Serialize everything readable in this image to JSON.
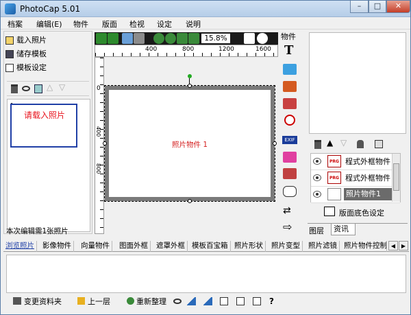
{
  "window": {
    "title": "PhotoCap 5.01",
    "controls": {
      "minimize": "–",
      "maximize": "□",
      "close": "✕"
    }
  },
  "menu": [
    "档案",
    "编辑(E)",
    "物件",
    "版面",
    "检视",
    "设定",
    "说明"
  ],
  "left_panel": {
    "commands": [
      "载入照片",
      "储存模板",
      "模板设定"
    ],
    "photo_placeholder_num": "1",
    "photo_placeholder": "请载入照片",
    "status": "本次编辑需1张照片"
  },
  "canvas": {
    "zoom": "15.8%",
    "ruler_ticks": [
      "400",
      "800",
      "1200",
      "1600"
    ],
    "vruler_ticks": [
      "0",
      "400",
      "800"
    ],
    "object_label": "照片物件 1"
  },
  "tools": {
    "header": "物件",
    "exif": "EXIF"
  },
  "right_panel": {
    "layers": [
      {
        "label": "程式外框物件",
        "selected": false
      },
      {
        "label": "程式外框物件",
        "selected": false
      },
      {
        "label": "照片物件1",
        "selected": true
      }
    ],
    "bg_color_label": "版面底色设定",
    "tabs": [
      "图层",
      "资讯"
    ]
  },
  "bottom_tabs": [
    "浏览照片",
    "影像物件",
    "向量物件",
    "图面外框",
    "遮罩外框",
    "模板百宝箱",
    "照片形状",
    "照片变型",
    "照片滤镜",
    "照片物件控制"
  ],
  "bottom_bar": {
    "change_folder": "变更资料夹",
    "up_level": "上一层",
    "refresh": "重新整理",
    "help": "?"
  },
  "colors": {
    "accent": "#1f3fa6",
    "placeholder_text": "#e8141e",
    "object_label": "#d42020"
  }
}
